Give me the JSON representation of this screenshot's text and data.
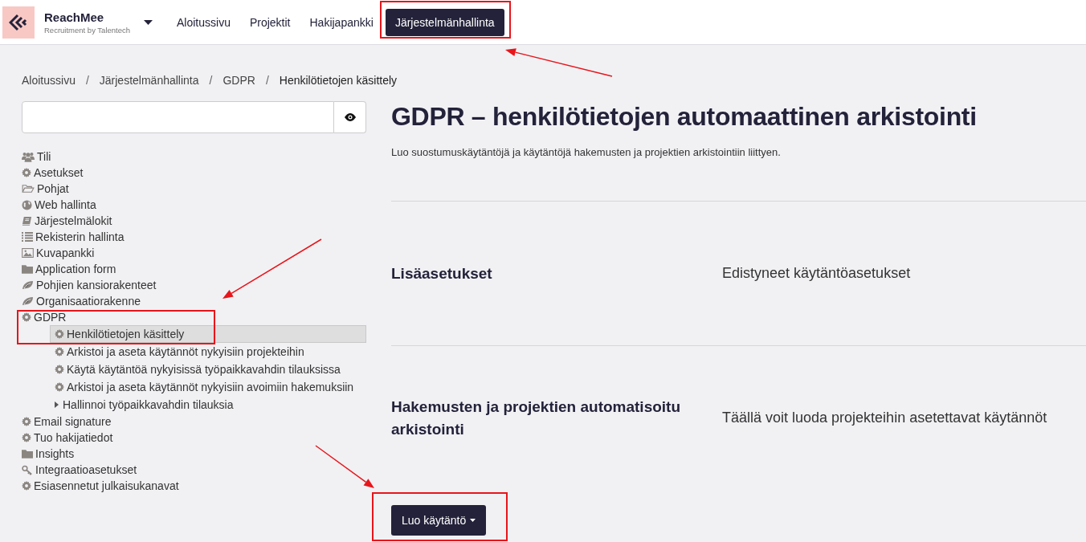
{
  "header": {
    "brand": "ReachMee",
    "tagline": "Recruitment by Talentech",
    "nav": [
      {
        "label": "Aloitussivu",
        "selected": false
      },
      {
        "label": "Projektit",
        "selected": false
      },
      {
        "label": "Hakijapankki",
        "selected": false
      },
      {
        "label": "Järjestelmänhallinta",
        "selected": true
      }
    ]
  },
  "breadcrumb": [
    "Aloitussivu",
    "Järjestelmänhallinta",
    "GDPR",
    "Henkilötietojen käsittely"
  ],
  "breadcrumb_separator": "/",
  "sidebar": {
    "items": [
      {
        "label": "Tili",
        "selected": false
      },
      {
        "label": "Asetukset",
        "selected": false
      },
      {
        "label": "Pohjat",
        "selected": false
      },
      {
        "label": "Web hallinta",
        "selected": false
      },
      {
        "label": "Järjestelmälokit",
        "selected": false
      },
      {
        "label": "Rekisterin hallinta",
        "selected": false
      },
      {
        "label": "Kuvapankki",
        "selected": false
      },
      {
        "label": "Application form",
        "selected": false
      },
      {
        "label": "Pohjien kansiorakenteet",
        "selected": false
      },
      {
        "label": "Organisaatiorakenne",
        "selected": false
      },
      {
        "label": "GDPR",
        "selected": false,
        "children": [
          {
            "label": "Henkilötietojen käsittely",
            "selected": true
          },
          {
            "label": "Arkistoi ja aseta käytännöt nykyisiin projekteihin",
            "selected": false
          },
          {
            "label": "Käytä käytäntöä nykyisissä työpaikkavahdin tilauksissa",
            "selected": false
          },
          {
            "label": "Arkistoi ja aseta käytännöt nykyisiin avoimiin hakemuksiin",
            "selected": false
          },
          {
            "label": "Hallinnoi työpaikkavahdin tilauksia",
            "selected": false,
            "expanded": false
          }
        ]
      },
      {
        "label": "Email signature",
        "selected": false
      },
      {
        "label": "Tuo hakijatiedot",
        "selected": false
      },
      {
        "label": "Insights",
        "selected": false
      },
      {
        "label": "Integraatioasetukset",
        "selected": false
      },
      {
        "label": "Esiasennetut julkaisukanavat",
        "selected": false
      }
    ]
  },
  "main": {
    "title": "GDPR – henkilötietojen automaattinen arkistointi",
    "subtitle": "Luo suostumuskäytäntöjä ja käytäntöjä hakemusten ja projektien arkistointiin liittyen.",
    "sections": [
      {
        "title": "Lisäasetukset",
        "description": "Edistyneet käytäntöasetukset"
      },
      {
        "title": "Hakemusten ja projektien automatisoitu arkistointi",
        "description": "Täällä voit luoda projekteihin asetettavat käytännöt"
      }
    ],
    "button": "Luo käytäntö"
  }
}
